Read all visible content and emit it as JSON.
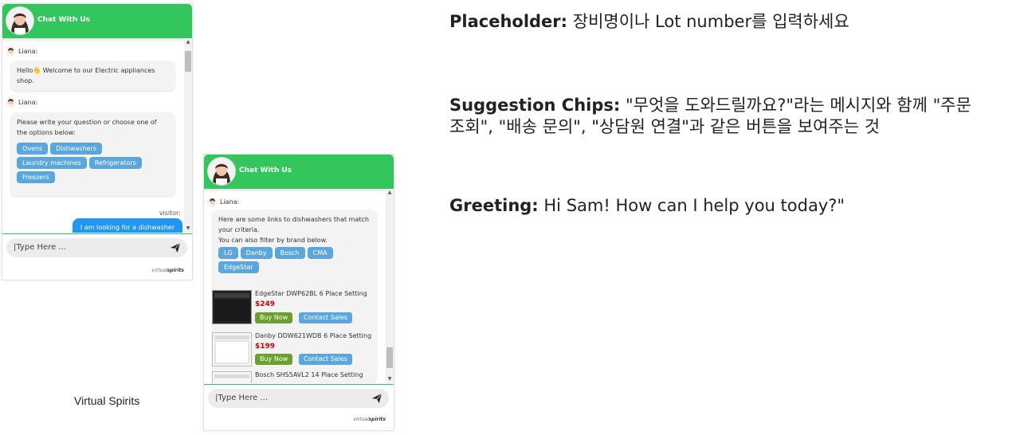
{
  "widget": {
    "title": "Chat With Us",
    "agent_name": "Liana:",
    "visitor_label": "visitor:",
    "input_placeholder": "Type Here ...",
    "brand_prefix": "virtual",
    "brand_suffix": "spirits"
  },
  "chat1": {
    "greeting": "Hello👋 Welcome to our Electric appliances shop.",
    "prompt": "Please write your question or choose one of the options below:",
    "chips": [
      "Ovens",
      "Dishwashers",
      "Laundry machines",
      "Refrigerators",
      "Freezers"
    ],
    "visitor_message": "I am looking for a dishwasher"
  },
  "chat2": {
    "reply_line1": "Here are some links to dishwashers that match your criteria.",
    "reply_line2": "You can also filter by brand below.",
    "brand_chips": [
      "LG",
      "Danby",
      "Bosch",
      "CMA",
      "EdgeStar"
    ],
    "products": [
      {
        "name": "EdgeStar DWP62BL 6 Place Setting",
        "price": "$249",
        "image": "dark"
      },
      {
        "name": "Danby DDW621WDB 6 Place Setting",
        "price": "$199",
        "image": "white"
      },
      {
        "name": "Bosch SHS5AVL2 14 Place Setting",
        "price": "",
        "image": "white"
      }
    ],
    "buy_label": "Buy Now",
    "contact_label": "Contact Sales"
  },
  "caption": "Virtual Spirits",
  "notes": {
    "placeholder_label": "Placeholder:",
    "placeholder_text": "장비명이나 Lot number를 입력하세요",
    "chips_label": "Suggestion Chips:",
    "chips_text_1": "\"무엇을 도와드릴까요?\"라는 메시지와 함께 \"주문",
    "chips_text_2": "조회\", \"배송 문의\", \"상담원 연결\"과 같은 버튼을 보여주는 것",
    "greeting_label": "Greeting:",
    "greeting_text": "Hi Sam! How can I help you today?\""
  },
  "colors": {
    "header_green": "#33c65c",
    "chip_blue": "#5ba6dd",
    "visitor_blue": "#2196f3",
    "buy_green": "#6aa12e",
    "price_red": "#cc0000"
  }
}
